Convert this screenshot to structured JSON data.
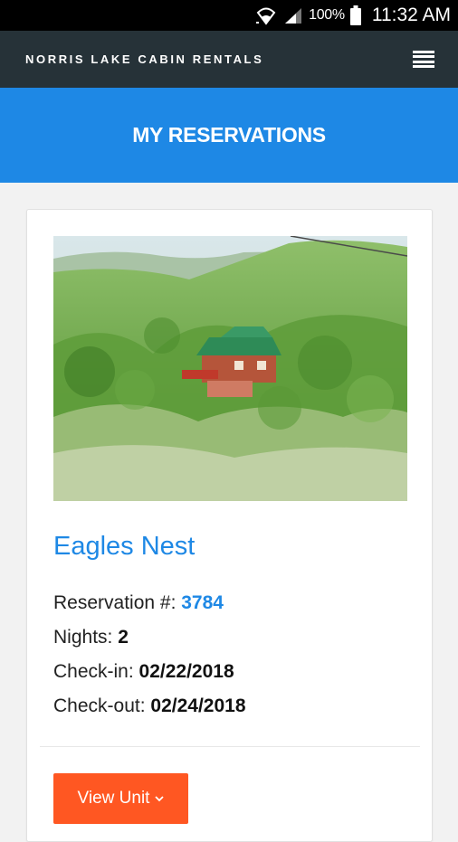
{
  "status_bar": {
    "battery_percent": "100%",
    "time": "11:32 AM",
    "icons": [
      "wifi-icon",
      "signal-icon",
      "battery-icon"
    ]
  },
  "navbar": {
    "brand": "NORRIS LAKE CABIN RENTALS",
    "menu_icon": "hamburger-icon"
  },
  "banner": {
    "title": "MY RESERVATIONS"
  },
  "reservation": {
    "unit_name": "Eagles Nest",
    "reservation_label": "Reservation #:",
    "reservation_number": "3784",
    "nights_label": "Nights:",
    "nights": "2",
    "checkin_label": "Check-in:",
    "checkin": "02/22/2018",
    "checkout_label": "Check-out:",
    "checkout": "02/24/2018",
    "button_label": "View Unit",
    "button_icon": "chevron-down-icon"
  },
  "colors": {
    "navbar_bg": "#263238",
    "banner_bg": "#1e88e5",
    "accent_blue": "#1e88e5",
    "button_orange": "#ff5722"
  }
}
